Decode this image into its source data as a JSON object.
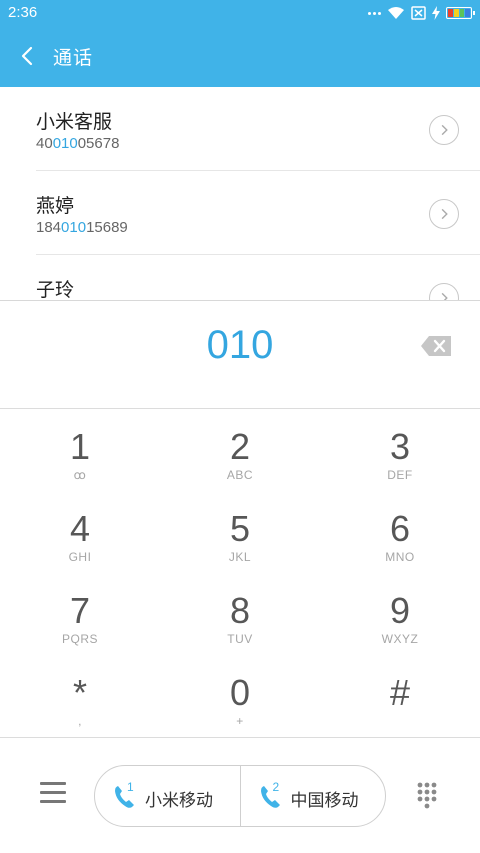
{
  "status_bar": {
    "time": "2:36"
  },
  "header": {
    "title": "通话",
    "back_icon": "back-arrow-icon"
  },
  "contacts": [
    {
      "name": "小米客服",
      "number_prefix": "40",
      "number_match": "010",
      "number_suffix": "05678"
    },
    {
      "name": "燕婷",
      "number_prefix": "184",
      "number_match": "010",
      "number_suffix": "15689"
    },
    {
      "name": "子玲"
    }
  ],
  "dial_display": {
    "digits": "010"
  },
  "keypad": [
    {
      "digit": "1",
      "letters": "ꝏ"
    },
    {
      "digit": "2",
      "letters": "ABC"
    },
    {
      "digit": "3",
      "letters": "DEF"
    },
    {
      "digit": "4",
      "letters": "GHI"
    },
    {
      "digit": "5",
      "letters": "JKL"
    },
    {
      "digit": "6",
      "letters": "MNO"
    },
    {
      "digit": "7",
      "letters": "PQRS"
    },
    {
      "digit": "8",
      "letters": "TUV"
    },
    {
      "digit": "9",
      "letters": "WXYZ"
    },
    {
      "digit": "*",
      "letters": ","
    },
    {
      "digit": "0",
      "letters": "+"
    },
    {
      "digit": "#",
      "letters": ""
    }
  ],
  "bottom_bar": {
    "sim1": {
      "slot": "1",
      "carrier": "小米移动"
    },
    "sim2": {
      "slot": "2",
      "carrier": "中国移动"
    }
  },
  "colors": {
    "accent": "#40b3e8",
    "highlight": "#34a6e0"
  }
}
